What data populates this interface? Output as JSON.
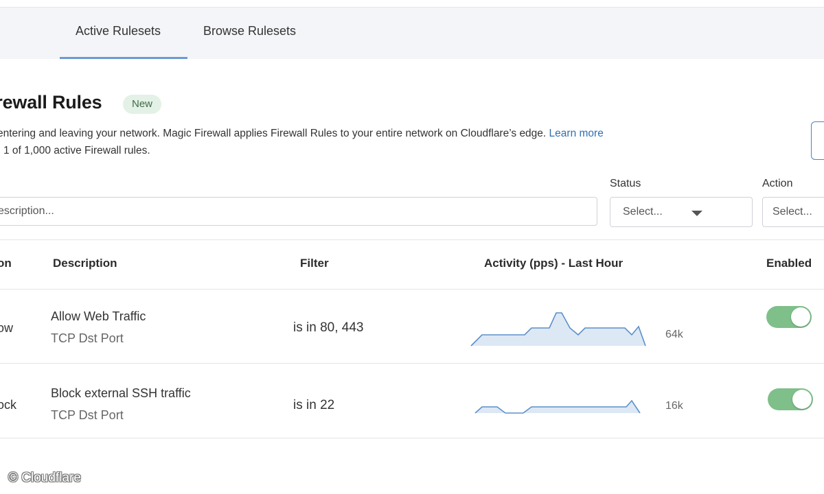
{
  "tabs": {
    "active_rulesets": "Active Rulesets",
    "browse_rulesets": "Browse Rulesets"
  },
  "section": {
    "title": "irewall Rules",
    "badge": "New",
    "description": "entering and leaving your network. Magic Firewall applies Firewall Rules to your entire network on Cloudflare’s edge.",
    "learn_more": "Learn more",
    "count_text": "1 of 1,000 active Firewall rules."
  },
  "filters": {
    "search_placeholder": "escription...",
    "status_label": "Status",
    "status_placeholder": "Select...",
    "action_label": "Action",
    "action_placeholder": "Select..."
  },
  "table": {
    "headers": {
      "action": "on",
      "description": "Description",
      "filter": "Filter",
      "activity": "Activity (pps) - Last Hour",
      "enabled": "Enabled"
    },
    "rows": [
      {
        "action": "ow",
        "description": "Allow Web Traffic",
        "field": "TCP Dst Port",
        "filter": "is in 80, 443",
        "activity_value": "64k",
        "enabled": true
      },
      {
        "action": "ock",
        "description": "Block external SSH traffic",
        "field": "TCP Dst Port",
        "filter": "is in 22",
        "activity_value": "16k",
        "enabled": true
      }
    ]
  },
  "colors": {
    "toggle_on": "#7fbf8a",
    "link": "#2f6fb3",
    "sparkline_stroke": "#5b8fc9",
    "sparkline_fill": "#dde8f5"
  },
  "watermark": "© Cloudflare"
}
